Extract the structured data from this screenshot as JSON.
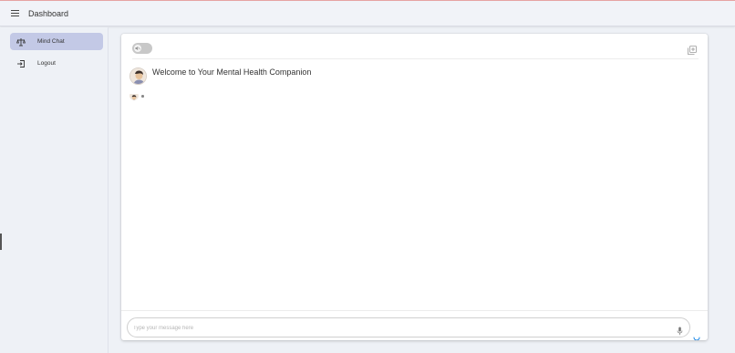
{
  "header": {
    "title": "Dashboard",
    "menu_icon": "menu-icon"
  },
  "sidebar": {
    "items": [
      {
        "label": "Mind Chat",
        "icon": "scale-icon",
        "active": true
      },
      {
        "label": "Logout",
        "icon": "logout-icon",
        "active": false
      }
    ],
    "active_color": "#c3c9e6"
  },
  "chat": {
    "welcome_message": "Welcome to Your Mental Health Companion",
    "sound_toggle": {
      "icon": "volume-off-icon",
      "on": false
    },
    "new_chat_icon": "add-box-icon",
    "input_placeholder": "Type your message here",
    "input_value": "",
    "mic_icon": "mic-icon",
    "loading": true
  },
  "colors": {
    "accent": "#1e88e5",
    "background": "#eef1f6",
    "card": "#ffffff"
  }
}
